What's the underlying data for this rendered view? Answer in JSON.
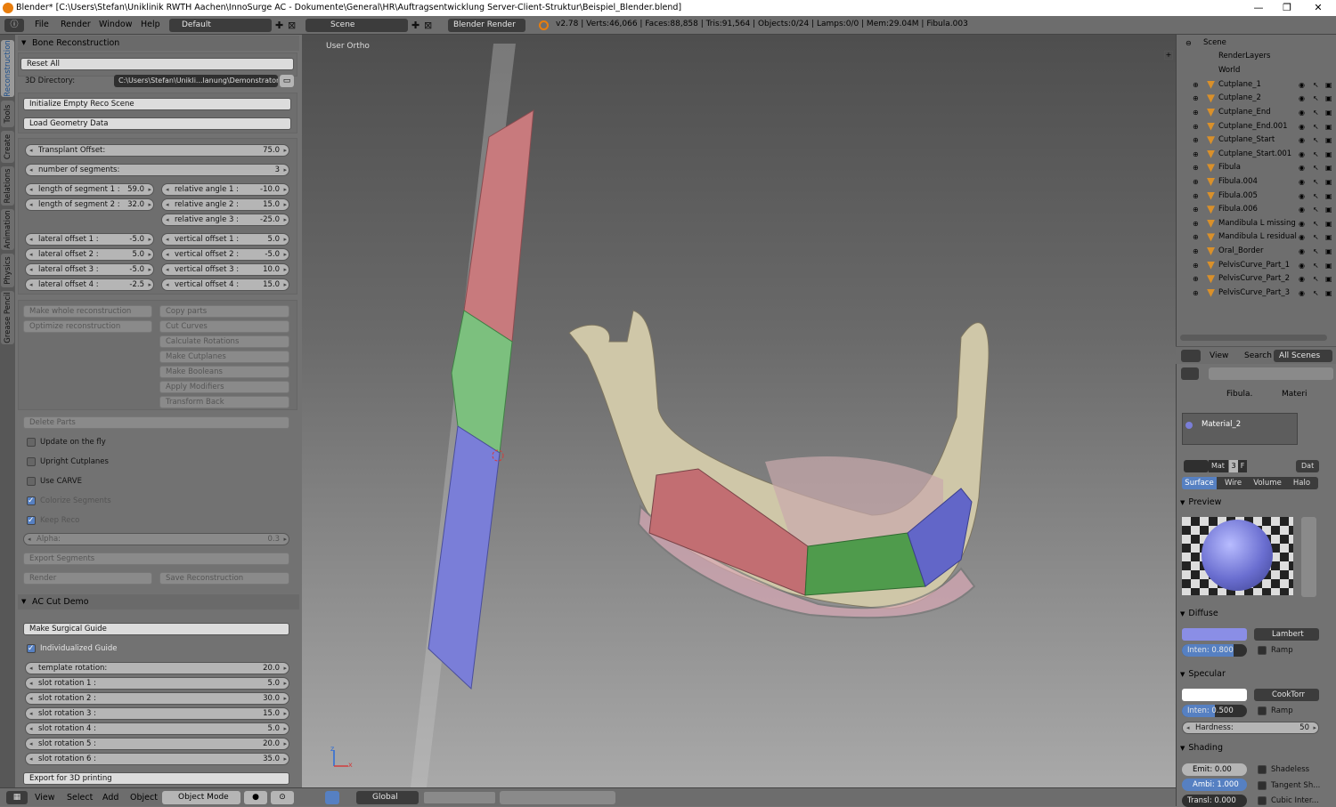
{
  "titlebar": {
    "title": "Blender* [C:\\Users\\Stefan\\Uniklinik RWTH Aachen\\InnoSurge AC - Dokumente\\General\\HR\\Auftragsentwicklung Server-Client-Struktur\\Beispiel_Blender.blend]",
    "minimize": "—",
    "restore": "❐",
    "close": "✕"
  },
  "infobar": {
    "menus": [
      "File",
      "Render",
      "Window",
      "Help"
    ],
    "layout": "Default",
    "scene": "Scene",
    "engine": "Blender Render",
    "stats": "v2.78 | Verts:46,066 | Faces:88,858 | Tris:91,564 | Objects:0/24 | Lamps:0/0 | Mem:29.04M | Fibula.003"
  },
  "tabs": [
    "Reconstruction",
    "Tools",
    "Create",
    "Relations",
    "Animation",
    "Physics",
    "Grease Pencil"
  ],
  "bone": {
    "header": "Bone Reconstruction",
    "reset_all": "Reset All",
    "dir_label": "3D Directory:",
    "dir_value": "C:\\Users\\Stefan\\Unikli...lanung\\Demonstraton\\",
    "init_scene": "Initialize Empty Reco Scene",
    "load_geo": "Load Geometry Data",
    "transplant_offset": {
      "label": "Transplant Offset:",
      "value": "75.0"
    },
    "num_segments": {
      "label": "number of segments:",
      "value": "3"
    },
    "lengths": [
      {
        "label": "length of segment 1 :",
        "value": "59.0"
      },
      {
        "label": "length of segment 2 :",
        "value": "32.0"
      }
    ],
    "angles": [
      {
        "label": "relative angle 1 :",
        "value": "-10.0"
      },
      {
        "label": "relative angle 2 :",
        "value": "15.0"
      },
      {
        "label": "relative angle 3 :",
        "value": "-25.0"
      }
    ],
    "lateral": [
      {
        "label": "lateral offset 1 :",
        "value": "-5.0"
      },
      {
        "label": "lateral offset 2 :",
        "value": "5.0"
      },
      {
        "label": "lateral offset 3 :",
        "value": "-5.0"
      },
      {
        "label": "lateral offset 4 :",
        "value": "-2.5"
      }
    ],
    "vertical": [
      {
        "label": "vertical offset 1 :",
        "value": "5.0"
      },
      {
        "label": "vertical offset 2 :",
        "value": "-5.0"
      },
      {
        "label": "vertical offset 3 :",
        "value": "10.0"
      },
      {
        "label": "vertical offset 4 :",
        "value": "15.0"
      }
    ],
    "left_ops": [
      "Make whole reconstruction",
      "Optimize reconstruction"
    ],
    "right_ops": [
      "Copy parts",
      "Cut Curves",
      "Calculate Rotations",
      "Make Cutplanes",
      "Make Booleans",
      "Apply Modifiers",
      "Transform Back"
    ],
    "delete_parts": "Delete Parts",
    "checks": [
      {
        "label": "Update on the fly",
        "on": false,
        "dis": false
      },
      {
        "label": "Upright Cutplanes",
        "on": false,
        "dis": false
      },
      {
        "label": "Use CARVE",
        "on": false,
        "dis": false
      },
      {
        "label": "Colorize Segments",
        "on": true,
        "dis": true
      },
      {
        "label": "Keep Reco",
        "on": true,
        "dis": true
      }
    ],
    "alpha": {
      "label": "Alpha:",
      "value": "0.3"
    },
    "export_segments": "Export Segments",
    "render": "Render",
    "save_reco": "Save Reconstruction"
  },
  "accut": {
    "header": "AC Cut Demo",
    "make_guide": "Make Surgical Guide",
    "individualized": "Individualized Guide",
    "template_rotation": {
      "label": "template rotation:",
      "value": "20.0"
    },
    "slots": [
      {
        "label": "slot rotation 1 :",
        "value": "5.0"
      },
      {
        "label": "slot rotation 2 :",
        "value": "30.0"
      },
      {
        "label": "slot rotation 3 :",
        "value": "15.0"
      },
      {
        "label": "slot rotation 4 :",
        "value": "5.0"
      },
      {
        "label": "slot rotation 5 :",
        "value": "20.0"
      },
      {
        "label": "slot rotation 6 :",
        "value": "35.0"
      }
    ],
    "export3d": "Export for 3D printing"
  },
  "viewport": {
    "label": "User Ortho",
    "axis_x": "x",
    "axis_z": "z"
  },
  "bottombar": {
    "menus": [
      "View",
      "Select",
      "Add",
      "Object"
    ],
    "mode": "Object Mode",
    "orientation": "Global"
  },
  "outliner": {
    "items": [
      "Scene",
      "RenderLayers",
      "World",
      "Cutplane_1",
      "Cutplane_2",
      "Cutplane_End",
      "Cutplane_End.001",
      "Cutplane_Start",
      "Cutplane_Start.001",
      "Fibula",
      "Fibula.004",
      "Fibula.005",
      "Fibula.006",
      "Mandibula L missing",
      "Mandibula L residual",
      "Oral_Border",
      "PelvisCurve_Part_1",
      "PelvisCurve_Part_2",
      "PelvisCurve_Part_3"
    ],
    "view": "View",
    "search": "Search",
    "all_scenes": "All Scenes"
  },
  "props": {
    "crumb_obj": "Fibula.",
    "crumb_mat": "Materi",
    "material": "Material_2",
    "mat_field": "Mat",
    "users": "3",
    "fake": "F",
    "data": "Dat",
    "tabs": [
      "Surface",
      "Wire",
      "Volume",
      "Halo"
    ],
    "preview": "Preview",
    "diffuse": "Diffuse",
    "diffuse_shader": "Lambert",
    "diffuse_inten": "Inten: 0.800",
    "ramp": "Ramp",
    "specular": "Specular",
    "spec_shader": "CookTorr",
    "spec_inten": "Inten: 0.500",
    "hardness_label": "Hardness:",
    "hardness": "50",
    "shading": "Shading",
    "emit": "Emit:  0.00",
    "ambi": "Ambi:  1.000",
    "transl": "Transl: 0.000",
    "shadeless": "Shadeless",
    "tangent": "Tangent Sh...",
    "cubic": "Cubic Inter..."
  },
  "colors": {
    "diffuse": "#8a8ee6",
    "specular": "#ffffff",
    "accent": "#5680c2"
  }
}
